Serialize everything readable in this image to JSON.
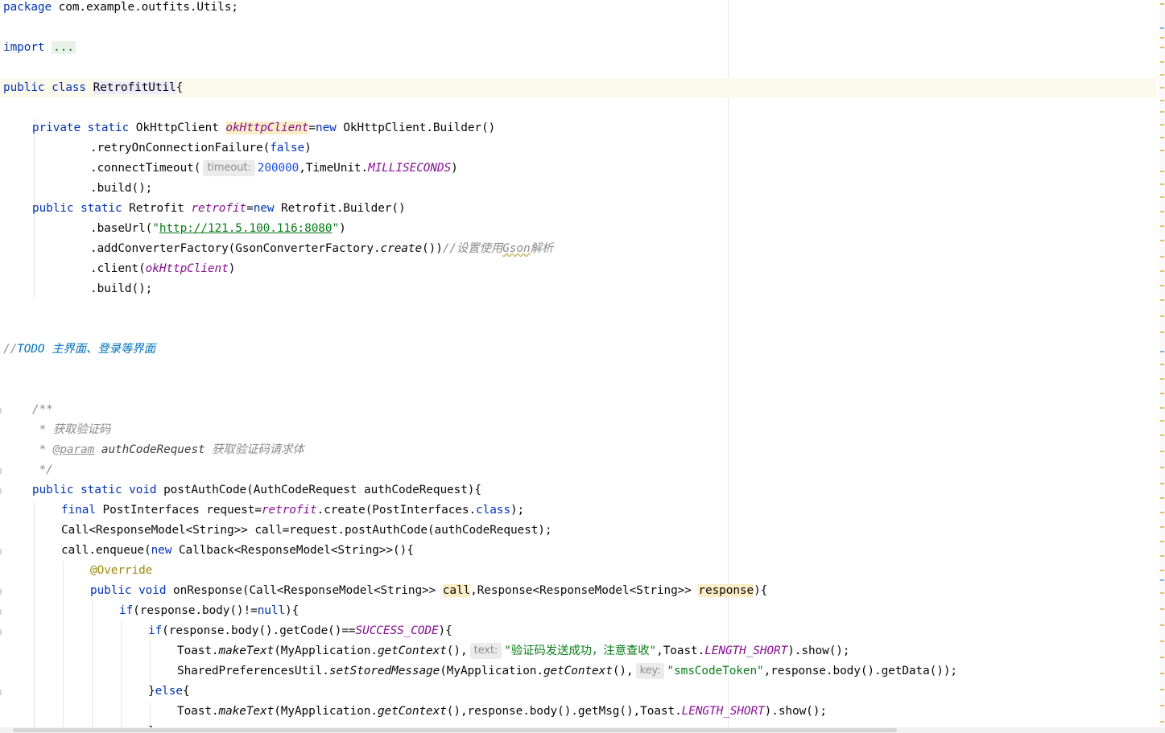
{
  "colors": {
    "keyword": "#0033b3",
    "field": "#871094",
    "string": "#067d17",
    "comment": "#8c8c8c",
    "todo": "#0073bf",
    "annotation": "#9e880d",
    "number": "#1750eb",
    "current_line": "#fcfaed"
  },
  "code": {
    "l1": {
      "kw": "package",
      "rest": " com.example.outfits.Utils;"
    },
    "l2": {
      "kw": "import",
      "fold": "..."
    },
    "l3": {
      "kw": "public class",
      "name": "RetrofitUtil",
      "rest": "{"
    },
    "l4": {
      "kw1": "private static",
      "t1": " OkHttpClient ",
      "field": "okHttpClient",
      "t2": "=",
      "kw2": "new",
      "t3": " OkHttpClient.Builder()"
    },
    "l5": {
      "t1": ".retryOnConnectionFailure(",
      "kw": "false",
      "t2": ")"
    },
    "l6": {
      "t1": ".connectTimeout(",
      "hint": "timeout:",
      "num": "200000",
      "t2": ",TimeUnit.",
      "const": "MILLISECONDS",
      "t3": ")"
    },
    "l7": {
      "t1": ".build();"
    },
    "l8": {
      "kw1": "public static",
      "t1": " Retrofit ",
      "field": "retrofit",
      "t2": "=",
      "kw2": "new",
      "t3": " Retrofit.Builder()"
    },
    "l9": {
      "t1": ".baseUrl(",
      "q1": "\"",
      "url": "http://121.5.100.116:8080",
      "q2": "\"",
      "t2": ")"
    },
    "l10": {
      "t1": ".addConverterFactory(GsonConverterFactory.",
      "st": "create",
      "t2": "())",
      "cmt1": "//设置使用",
      "cmt2": "Gson",
      "cmt3": "解析"
    },
    "l11": {
      "t1": ".client(",
      "field": "okHttpClient",
      "t2": ")"
    },
    "l12": {
      "t1": ".build();"
    },
    "l13": {
      "c1": "//",
      "todo": "TODO 主界面、登录等界面"
    },
    "l14": {
      "cmt": "/**"
    },
    "l15": {
      "cmt": " * 获取验证码"
    },
    "l16": {
      "c1": " * ",
      "tag": "@param",
      "param": " authCodeRequest",
      "desc": " 获取验证码请求体"
    },
    "l17": {
      "cmt": " */"
    },
    "l18": {
      "kw": "public static void",
      "t1": " postAuthCode(AuthCodeRequest authCodeRequest){"
    },
    "l19": {
      "kw1": "final",
      "t1": " PostInterfaces request=",
      "field": "retrofit",
      "t2": ".create(PostInterfaces.",
      "kw2": "class",
      "t3": ");"
    },
    "l20": {
      "t1": "Call<ResponseModel<String>> call=request.postAuthCode(authCodeRequest);"
    },
    "l21": {
      "t1": "call.enqueue(",
      "kw": "new",
      "t2": " Callback<ResponseModel<String>>(){"
    },
    "l22": {
      "ann": "@Override"
    },
    "l23": {
      "kw": "public void",
      "t1": " onResponse(Call<ResponseModel<String>> ",
      "v1": "call",
      "t2": ",Response<ResponseModel<String>> ",
      "v2": "response",
      "t3": "){"
    },
    "l24": {
      "kw1": "if",
      "t1": "(response.body()!=",
      "kw2": "null",
      "t2": "){"
    },
    "l25": {
      "kw": "if",
      "t1": "(response.body().getCode()==",
      "const": "SUCCESS_CODE",
      "t2": "){"
    },
    "l26": {
      "t1": "Toast.",
      "st1": "makeText",
      "t2": "(MyApplication.",
      "st2": "getContext",
      "t3": "(),",
      "hint": "text:",
      "str": "\"验证码发送成功，注意查收\"",
      "t4": ",Toast.",
      "const": "LENGTH_SHORT",
      "t5": ").show();"
    },
    "l27": {
      "t1": "SharedPreferencesUtil.",
      "st1": "setStoredMessage",
      "t2": "(MyApplication.",
      "st2": "getContext",
      "t3": "(),",
      "hint": "key:",
      "str": "\"smsCodeToken\"",
      "t4": ",response.body().getData());"
    },
    "l28": {
      "t1": "}",
      "kw": "else",
      "t2": "{"
    },
    "l29": {
      "t1": "Toast.",
      "st1": "makeText",
      "t2": "(MyApplication.",
      "st2": "getContext",
      "t3": "(),response.body().getMsg(),Toast.",
      "const": "LENGTH_SHORT",
      "t4": ").show();"
    },
    "l30": {
      "t1": "}"
    }
  }
}
